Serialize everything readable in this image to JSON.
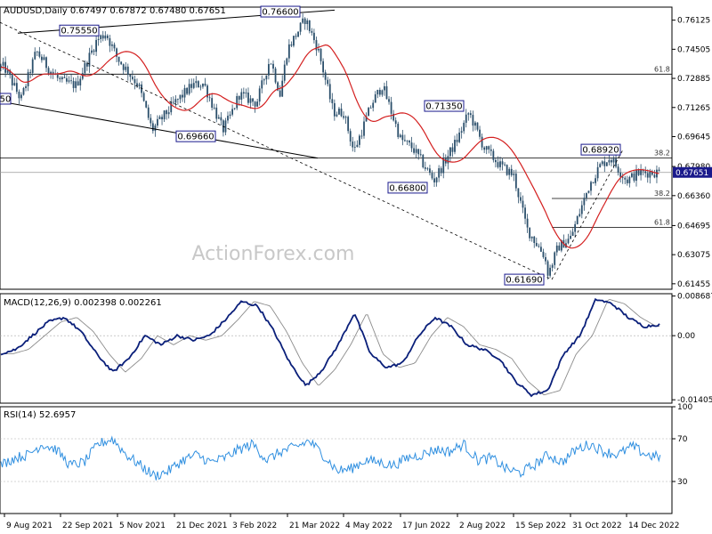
{
  "header": {
    "symbol": "AUDUSD,Daily",
    "ohlc": "0.67497 0.67872 0.67480 0.67651"
  },
  "watermark": "ActionForex.com",
  "colors": {
    "candle": "#2b4f6b",
    "sma": "#d42020",
    "macd": "#0a1f7a",
    "signal": "#8c8c8c",
    "rsi": "#2f8fe0",
    "box_border": "#1a1a8c",
    "current_price_bg": "#1a1a8c"
  },
  "chart_data": [
    {
      "type": "candlestick",
      "title": "AUDUSD,Daily",
      "x_labels": [
        "9 Aug 2021",
        "22 Sep 2021",
        "5 Nov 2021",
        "21 Dec 2021",
        "3 Feb 2022",
        "21 Mar 2022",
        "4 May 2022",
        "17 Jun 2022",
        "2 Aug 2022",
        "15 Sep 2022",
        "31 Oct 2022",
        "14 Dec 2022"
      ],
      "y_ticks": [
        "0.76125",
        "0.74505",
        "0.72885",
        "0.71265",
        "0.69645",
        "0.67980",
        "0.66360",
        "0.64695",
        "0.63075",
        "0.61455"
      ],
      "ylim": [
        0.6115,
        0.7685
      ],
      "current_price": "0.67651",
      "swing_labels": [
        "0.75550",
        "0.76600",
        "0.69660",
        "0.71350",
        "0.66800",
        "0.68920",
        "0.61690"
      ],
      "fib_labels": [
        "61.8",
        "38.2",
        "38.2",
        "61.8"
      ],
      "left_edge_label": "50",
      "moving_average": "red SMA",
      "close_path": [
        [
          "9 Aug 2021",
          0.735
        ],
        [
          "22 Aug 2021",
          0.717
        ],
        [
          "3 Sep 2021",
          0.744
        ],
        [
          "13 Sep 2021",
          0.734
        ],
        [
          "22 Sep 2021",
          0.727
        ],
        [
          "4 Oct 2021",
          0.725
        ],
        [
          "20 Oct 2021",
          0.75
        ],
        [
          "27 Oct 2021",
          0.754
        ],
        [
          "5 Nov 2021",
          0.74
        ],
        [
          "22 Nov 2021",
          0.725
        ],
        [
          "3 Dec 2021",
          0.7
        ],
        [
          "21 Dec 2021",
          0.715
        ],
        [
          "4 Jan 2022",
          0.725
        ],
        [
          "13 Jan 2022",
          0.726
        ],
        [
          "28 Jan 2022",
          0.7
        ],
        [
          "3 Feb 2022",
          0.708
        ],
        [
          "10 Feb 2022",
          0.72
        ],
        [
          "24 Feb 2022",
          0.715
        ],
        [
          "7 Mar 2022",
          0.74
        ],
        [
          "15 Mar 2022",
          0.72
        ],
        [
          "21 Mar 2022",
          0.745
        ],
        [
          "4 Apr 2022",
          0.762
        ],
        [
          "14 Apr 2022",
          0.745
        ],
        [
          "26 Apr 2022",
          0.71
        ],
        [
          "4 May 2022",
          0.71
        ],
        [
          "12 May 2022",
          0.688
        ],
        [
          "26 May 2022",
          0.715
        ],
        [
          "3 Jun 2022",
          0.725
        ],
        [
          "17 Jun 2022",
          0.695
        ],
        [
          "27 Jun 2022",
          0.69
        ],
        [
          "14 Jul 2022",
          0.672
        ],
        [
          "2 Aug 2022",
          0.695
        ],
        [
          "11 Aug 2022",
          0.71
        ],
        [
          "23 Aug 2022",
          0.69
        ],
        [
          "5 Sep 2022",
          0.68
        ],
        [
          "15 Sep 2022",
          0.675
        ],
        [
          "26 Sep 2022",
          0.645
        ],
        [
          "10 Oct 2022",
          0.63
        ],
        [
          "13 Oct 2022",
          0.62
        ],
        [
          "21 Oct 2022",
          0.635
        ],
        [
          "31 Oct 2022",
          0.64
        ],
        [
          "15 Nov 2022",
          0.67
        ],
        [
          "23 Nov 2022",
          0.68
        ],
        [
          "1 Dec 2022",
          0.685
        ],
        [
          "14 Dec 2022",
          0.672
        ],
        [
          "23 Dec 2022",
          0.676
        ],
        [
          "30 Dec 2022",
          0.6765
        ]
      ]
    },
    {
      "type": "line",
      "title": "MACD(12,26,9) 0.002398 0.002261",
      "y_ticks": [
        "0.008687",
        "0.00",
        "-0.014056"
      ],
      "ylim": [
        -0.0148,
        0.0092
      ],
      "series": [
        {
          "name": "MACD",
          "values": [
            -0.004,
            -0.003,
            0.0,
            0.003,
            0.004,
            0.001,
            -0.004,
            -0.008,
            -0.005,
            0.0,
            -0.002,
            0.0,
            -0.001,
            0.0,
            0.0035,
            0.0075,
            0.0065,
            0.001,
            -0.006,
            -0.011,
            -0.0075,
            -0.002,
            0.005,
            -0.004,
            -0.007,
            -0.006,
            0.0,
            0.004,
            0.002,
            -0.002,
            -0.003,
            -0.005,
            -0.01,
            -0.013,
            -0.012,
            -0.004,
            0.0,
            0.008,
            0.007,
            0.004,
            0.002,
            0.0025
          ]
        }
      ]
    },
    {
      "type": "line",
      "title": "RSI(14) 52.6957",
      "y_ticks": [
        "100",
        "70",
        "30",
        "0"
      ],
      "ylim": [
        0,
        100
      ],
      "series": [
        {
          "name": "RSI(14)",
          "values": [
            45,
            52,
            55,
            65,
            60,
            45,
            48,
            65,
            70,
            55,
            45,
            35,
            40,
            50,
            55,
            48,
            52,
            60,
            65,
            50,
            58,
            62,
            68,
            55,
            40,
            42,
            50,
            48,
            45,
            52,
            55,
            60,
            58,
            65,
            50,
            52,
            42,
            38,
            45,
            55,
            48,
            60,
            65,
            58,
            55,
            63,
            55,
            52.7
          ]
        }
      ]
    }
  ]
}
